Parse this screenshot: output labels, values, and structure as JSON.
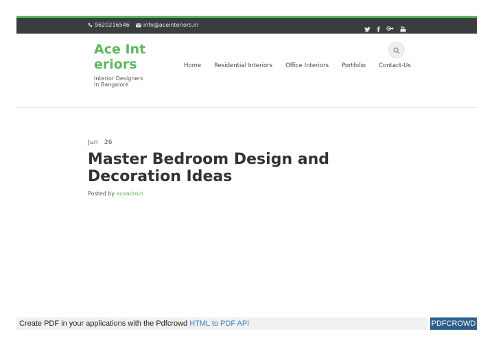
{
  "topbar": {
    "phone": "9620216546",
    "email": "info@aceinteriors.in",
    "social_icons": [
      "twitter-icon",
      "facebook-icon",
      "google-plus-icon",
      "youtube-icon"
    ]
  },
  "branding": {
    "title": "Ace Interiors",
    "tagline": "Interior Designers in Bangalore",
    "accent_color": "#5cb85c"
  },
  "nav": {
    "items": [
      "Home",
      "Residential Interiors",
      "Office Interiors",
      "Portfolio",
      "Contact-Us"
    ]
  },
  "post": {
    "date": "Jun   26",
    "title": "Master Bedroom Design and Decoration Ideas",
    "posted_by": "Posted by",
    "author": "aceadmin"
  },
  "pdfcrowd": {
    "text": "Create PDF in your applications with the Pdfcrowd",
    "link": "HTML to PDF API",
    "badge": "PDFCROWD"
  }
}
